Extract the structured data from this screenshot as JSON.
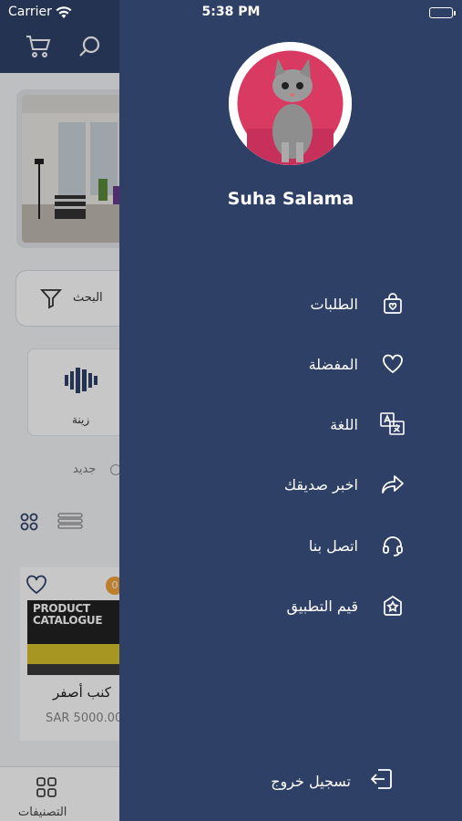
{
  "status_bar": {
    "carrier": "Carrier",
    "time": "5:38 PM"
  },
  "background": {
    "filter_label": "البحث",
    "category_label": "زينة",
    "sort_label": "جديد",
    "product": {
      "badge": "0",
      "image_line1": "PRODUCT",
      "image_line2": "CATALOGUE",
      "name": "كنب أصفر",
      "price": "SAR 5000.00"
    },
    "tabbar_label": "التصنيفات"
  },
  "drawer": {
    "user_name": "Suha Salama",
    "menu": [
      {
        "label": "الطلبات",
        "icon": "shopping-bag-icon"
      },
      {
        "label": "المفضلة",
        "icon": "heart-icon"
      },
      {
        "label": "اللغة",
        "icon": "translate-icon"
      },
      {
        "label": "اخبر صديقك",
        "icon": "share-icon"
      },
      {
        "label": "اتصل بنا",
        "icon": "headset-icon"
      },
      {
        "label": "قيم التطبيق",
        "icon": "star-icon"
      }
    ],
    "logout_label": "تسجيل خروج"
  },
  "colors": {
    "drawer_bg": "#2f4066",
    "header_bg": "#2e4268",
    "accent_badge": "#f0a33a"
  }
}
